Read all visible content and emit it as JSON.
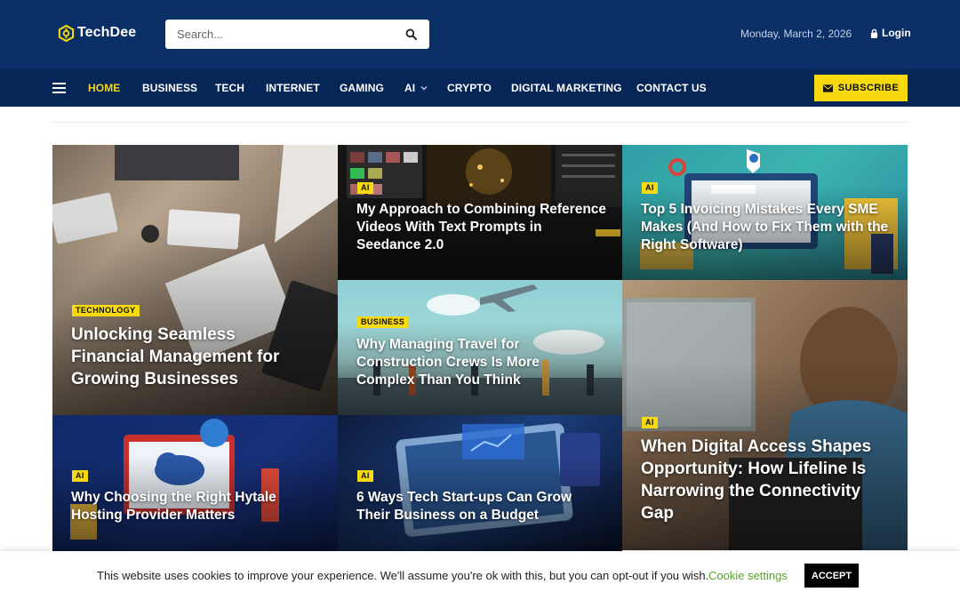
{
  "header": {
    "logo_text": "TechDee",
    "search_placeholder": "Search...",
    "date": "Monday, March 2, 2026",
    "login_label": "Login"
  },
  "nav": {
    "items": [
      {
        "label": "HOME",
        "active": true
      },
      {
        "label": "BUSINESS"
      },
      {
        "label": "TECH"
      },
      {
        "label": "INTERNET"
      },
      {
        "label": "GAMING"
      },
      {
        "label": "AI",
        "has_dropdown": true
      },
      {
        "label": "CRYPTO"
      },
      {
        "label": "DIGITAL MARKETING"
      },
      {
        "label": "CONTACT US"
      }
    ],
    "subscribe_label": "SUBSCRIBE"
  },
  "articles": [
    {
      "category": "TECHNOLOGY",
      "title": "Unlocking Seamless Financial Management for Growing Businesses"
    },
    {
      "category": "AI",
      "title": "My Approach to Combining Reference Videos With Text Prompts in Seedance 2.0"
    },
    {
      "category": "AI",
      "title": "Top 5 Invoicing Mistakes Every SME Makes (And How to Fix Them with the Right Software)"
    },
    {
      "category": "BUSINESS",
      "title": "Why Managing Travel for Construction Crews Is More Complex Than You Think"
    },
    {
      "category": "AI",
      "title": "When Digital Access Shapes Opportunity: How Lifeline Is Narrowing the Connectivity Gap"
    },
    {
      "category": "AI",
      "title": "Why Choosing the Right Hytale Hosting Provider Matters"
    },
    {
      "category": "AI",
      "title": "6 Ways Tech Start-ups Can Grow Their Business on a Budget"
    }
  ],
  "cookie": {
    "text": "This website uses cookies to improve your experience. We'll assume you're ok with this, but you can opt-out if you wish.",
    "settings_label": "Cookie settings",
    "accept_label": "ACCEPT"
  },
  "colors": {
    "header_bg": "#0a2f67",
    "nav_bg": "#062657",
    "accent_yellow": "#f6d90f",
    "cookie_link": "#5aa02c"
  }
}
